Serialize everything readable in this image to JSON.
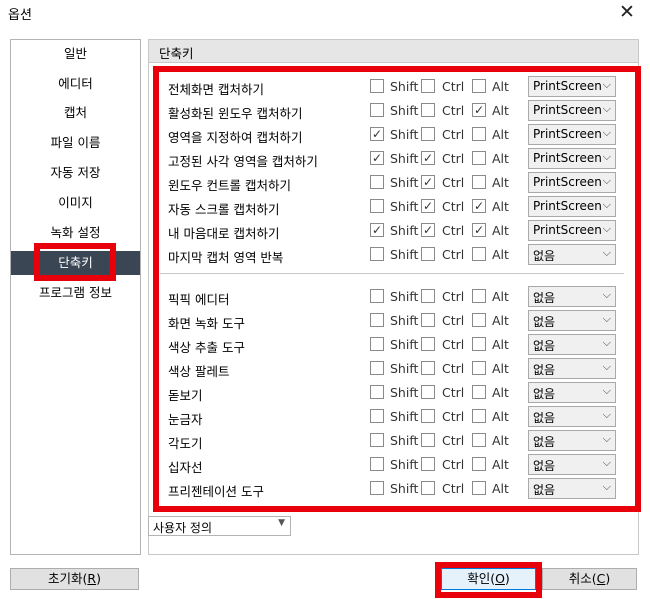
{
  "window": {
    "title": "옵션",
    "close_icon": "close-icon"
  },
  "nav": {
    "items": [
      {
        "label": "일반"
      },
      {
        "label": "에디터"
      },
      {
        "label": "캡처"
      },
      {
        "label": "파일 이름"
      },
      {
        "label": "자동 저장"
      },
      {
        "label": "이미지"
      },
      {
        "label": "녹화 설정"
      },
      {
        "label": "단축키",
        "selected": true
      },
      {
        "label": "프로그램 정보"
      }
    ]
  },
  "panel": {
    "title": "단축키",
    "labels": {
      "shift": "Shift",
      "ctrl": "Ctrl",
      "alt": "Alt"
    },
    "capture_shortcuts": [
      {
        "name": "전체화면 캡처하기",
        "shift": false,
        "ctrl": false,
        "alt": false,
        "key": "PrintScreen"
      },
      {
        "name": "활성화된 윈도우 캡처하기",
        "shift": false,
        "ctrl": false,
        "alt": true,
        "key": "PrintScreen"
      },
      {
        "name": "영역을 지정하여 캡처하기",
        "shift": true,
        "ctrl": false,
        "alt": false,
        "key": "PrintScreen"
      },
      {
        "name": "고정된 사각 영역을 캡처하기",
        "shift": true,
        "ctrl": true,
        "alt": false,
        "key": "PrintScreen"
      },
      {
        "name": "윈도우 컨트롤 캡처하기",
        "shift": false,
        "ctrl": true,
        "alt": false,
        "key": "PrintScreen"
      },
      {
        "name": "자동 스크롤 캡처하기",
        "shift": false,
        "ctrl": true,
        "alt": true,
        "key": "PrintScreen"
      },
      {
        "name": "내 마음대로 캡처하기",
        "shift": true,
        "ctrl": true,
        "alt": true,
        "key": "PrintScreen"
      },
      {
        "name": "마지막 캡처 영역 반복",
        "shift": false,
        "ctrl": false,
        "alt": false,
        "key": "없음"
      }
    ],
    "tool_shortcuts": [
      {
        "name": "픽픽 에디터",
        "shift": false,
        "ctrl": false,
        "alt": false,
        "key": "없음"
      },
      {
        "name": "화면 녹화 도구",
        "shift": false,
        "ctrl": false,
        "alt": false,
        "key": "없음"
      },
      {
        "name": "색상 추출 도구",
        "shift": false,
        "ctrl": false,
        "alt": false,
        "key": "없음"
      },
      {
        "name": "색상 팔레트",
        "shift": false,
        "ctrl": false,
        "alt": false,
        "key": "없음"
      },
      {
        "name": "돋보기",
        "shift": false,
        "ctrl": false,
        "alt": false,
        "key": "없음"
      },
      {
        "name": "눈금자",
        "shift": false,
        "ctrl": false,
        "alt": false,
        "key": "없음"
      },
      {
        "name": "각도기",
        "shift": false,
        "ctrl": false,
        "alt": false,
        "key": "없음"
      },
      {
        "name": "십자선",
        "shift": false,
        "ctrl": false,
        "alt": false,
        "key": "없음"
      },
      {
        "name": "프리젠테이션 도구",
        "shift": false,
        "ctrl": false,
        "alt": false,
        "key": "없음"
      }
    ],
    "preset": "사용자 정의"
  },
  "buttons": {
    "reset": {
      "label": "초기화(",
      "key": "R",
      "suffix": ")"
    },
    "ok": {
      "label": "확인(",
      "key": "O",
      "suffix": ")"
    },
    "cancel": {
      "label": "취소(",
      "key": "C",
      "suffix": ")"
    }
  },
  "highlight_color": "#e8000a"
}
